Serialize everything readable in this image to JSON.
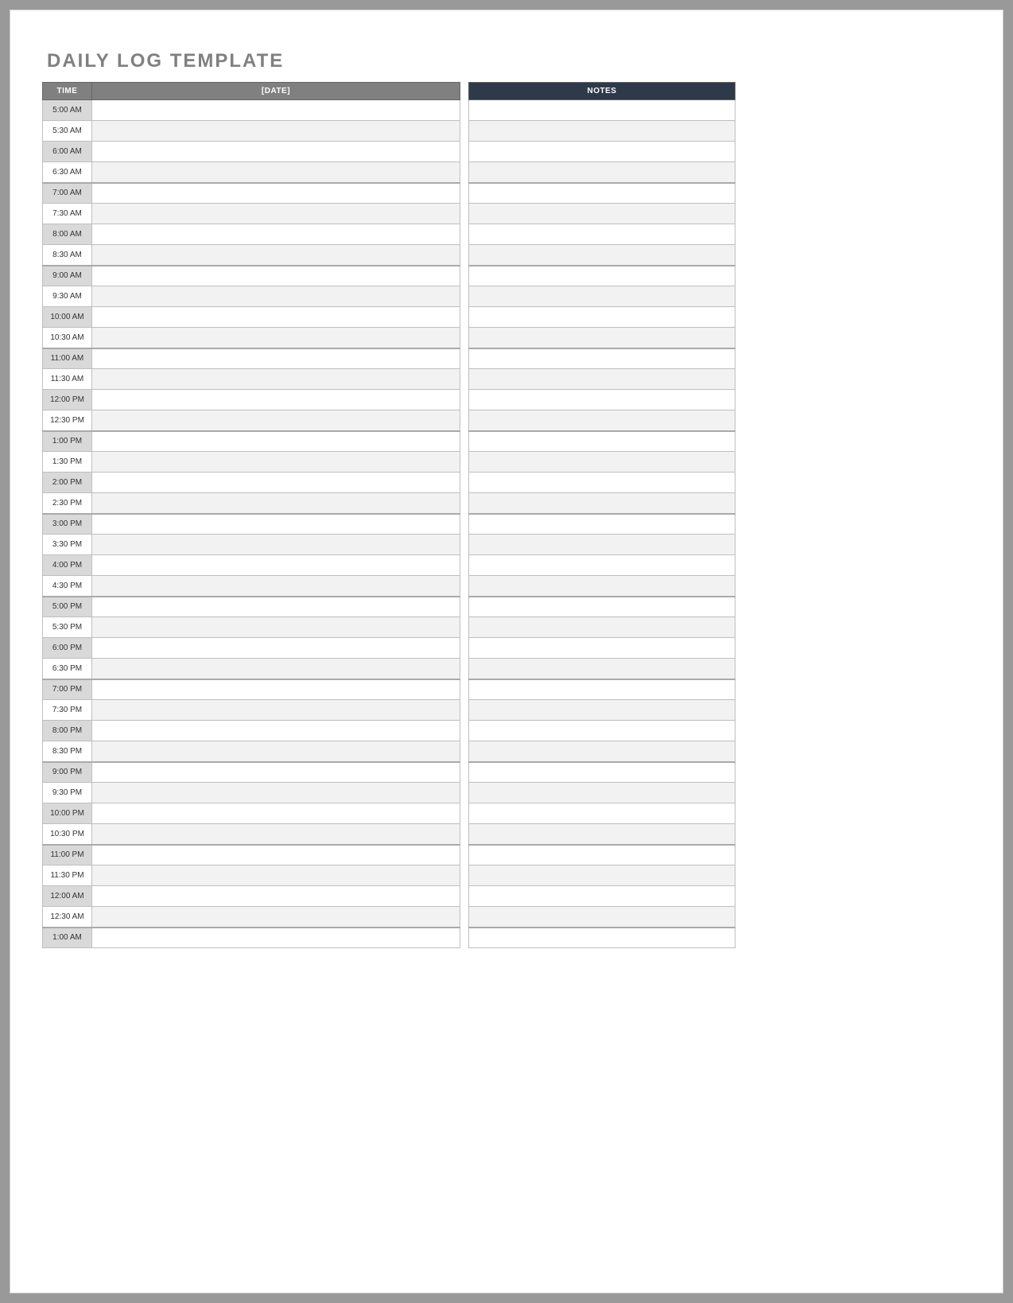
{
  "title": "DAILY LOG TEMPLATE",
  "headers": {
    "time": "TIME",
    "date": "[DATE]",
    "notes": "NOTES"
  },
  "rows": [
    {
      "time": "5:00 AM",
      "entry": "",
      "note": ""
    },
    {
      "time": "5:30 AM",
      "entry": "",
      "note": ""
    },
    {
      "time": "6:00 AM",
      "entry": "",
      "note": ""
    },
    {
      "time": "6:30 AM",
      "entry": "",
      "note": ""
    },
    {
      "time": "7:00 AM",
      "entry": "",
      "note": ""
    },
    {
      "time": "7:30 AM",
      "entry": "",
      "note": ""
    },
    {
      "time": "8:00 AM",
      "entry": "",
      "note": ""
    },
    {
      "time": "8:30 AM",
      "entry": "",
      "note": ""
    },
    {
      "time": "9:00 AM",
      "entry": "",
      "note": ""
    },
    {
      "time": "9:30 AM",
      "entry": "",
      "note": ""
    },
    {
      "time": "10:00 AM",
      "entry": "",
      "note": ""
    },
    {
      "time": "10:30 AM",
      "entry": "",
      "note": ""
    },
    {
      "time": "11:00 AM",
      "entry": "",
      "note": ""
    },
    {
      "time": "11:30 AM",
      "entry": "",
      "note": ""
    },
    {
      "time": "12:00 PM",
      "entry": "",
      "note": ""
    },
    {
      "time": "12:30 PM",
      "entry": "",
      "note": ""
    },
    {
      "time": "1:00 PM",
      "entry": "",
      "note": ""
    },
    {
      "time": "1:30 PM",
      "entry": "",
      "note": ""
    },
    {
      "time": "2:00 PM",
      "entry": "",
      "note": ""
    },
    {
      "time": "2:30 PM",
      "entry": "",
      "note": ""
    },
    {
      "time": "3:00 PM",
      "entry": "",
      "note": ""
    },
    {
      "time": "3:30 PM",
      "entry": "",
      "note": ""
    },
    {
      "time": "4:00 PM",
      "entry": "",
      "note": ""
    },
    {
      "time": "4:30 PM",
      "entry": "",
      "note": ""
    },
    {
      "time": "5:00 PM",
      "entry": "",
      "note": ""
    },
    {
      "time": "5:30 PM",
      "entry": "",
      "note": ""
    },
    {
      "time": "6:00 PM",
      "entry": "",
      "note": ""
    },
    {
      "time": "6:30 PM",
      "entry": "",
      "note": ""
    },
    {
      "time": "7:00 PM",
      "entry": "",
      "note": ""
    },
    {
      "time": "7:30 PM",
      "entry": "",
      "note": ""
    },
    {
      "time": "8:00 PM",
      "entry": "",
      "note": ""
    },
    {
      "time": "8:30 PM",
      "entry": "",
      "note": ""
    },
    {
      "time": "9:00 PM",
      "entry": "",
      "note": ""
    },
    {
      "time": "9:30 PM",
      "entry": "",
      "note": ""
    },
    {
      "time": "10:00 PM",
      "entry": "",
      "note": ""
    },
    {
      "time": "10:30 PM",
      "entry": "",
      "note": ""
    },
    {
      "time": "11:00 PM",
      "entry": "",
      "note": ""
    },
    {
      "time": "11:30 PM",
      "entry": "",
      "note": ""
    },
    {
      "time": "12:00 AM",
      "entry": "",
      "note": ""
    },
    {
      "time": "12:30 AM",
      "entry": "",
      "note": ""
    },
    {
      "time": "1:00 AM",
      "entry": "",
      "note": ""
    }
  ]
}
